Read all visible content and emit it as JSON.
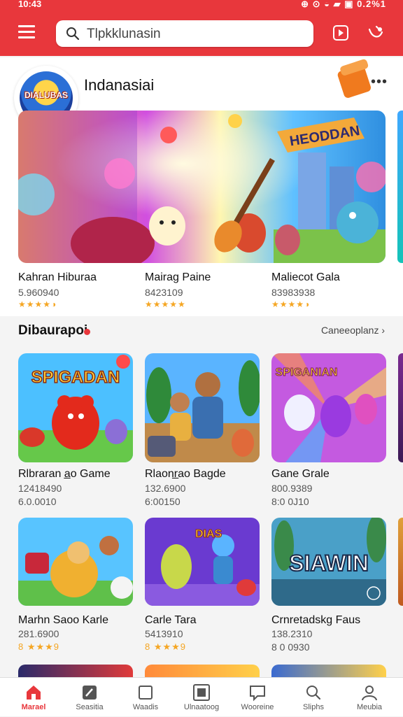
{
  "status": {
    "time": "10:43",
    "indicators": "⊕ ⊙ ◒ ▰ ▣ 0.2%1"
  },
  "search": {
    "placeholder": "Tlpkklunasin"
  },
  "section1": {
    "title": "Indanasiai",
    "logo_text": "DIALUBAS",
    "banner_sign": "HEODDAN"
  },
  "featured": [
    {
      "title": "Kahran Hiburaa",
      "sub": "5.960940",
      "stars": "★★★★◑"
    },
    {
      "title": "Mairag Paine",
      "sub": "8423109",
      "stars": "★★★★★"
    },
    {
      "title": "Maliecot Gala",
      "sub": "83983938",
      "stars": "★★★★◑"
    }
  ],
  "section2": {
    "title": "Dibaurapoi",
    "see_all": "Caneeoplanz ›"
  },
  "row1": [
    {
      "title": "Rlbraran a̲o Game",
      "sub1": "12418490",
      "sub2": "6.0.0010",
      "art": "SPIGADAN"
    },
    {
      "title": "Rlaonr̲ao Bagde",
      "sub1": "132.6900",
      "sub2": "6:00150",
      "art": ""
    },
    {
      "title": "Gane Grale",
      "sub1": "800.9389",
      "sub2": "8:0 0J10",
      "art": "SPIGANIAN"
    }
  ],
  "row2": [
    {
      "title": "Marhn Saoo Karle",
      "sub1": "281.6900",
      "stars": "8 ★★★9"
    },
    {
      "title": "Carle Tara",
      "sub1": "5413910",
      "stars": "8 ★★★9"
    },
    {
      "title": "Crnretadskg Faus",
      "sub1": "138.2310",
      "stars": "8 0 0930"
    }
  ],
  "row2_art": {
    "tile2": "DIAS",
    "tile3": "SIAWIN"
  },
  "nav": [
    {
      "label": "Marael",
      "icon": "home-icon"
    },
    {
      "label": "Seasitia",
      "icon": "edit-icon"
    },
    {
      "label": "Waadis",
      "icon": "square-icon"
    },
    {
      "label": "Ulnaatoog",
      "icon": "grid-icon"
    },
    {
      "label": "Wooreine",
      "icon": "chat-icon"
    },
    {
      "label": "Sliphs",
      "icon": "search-icon"
    },
    {
      "label": "Meubia",
      "icon": "user-icon"
    }
  ],
  "colors": {
    "brand": "#e8373c",
    "star": "#f5a623"
  }
}
